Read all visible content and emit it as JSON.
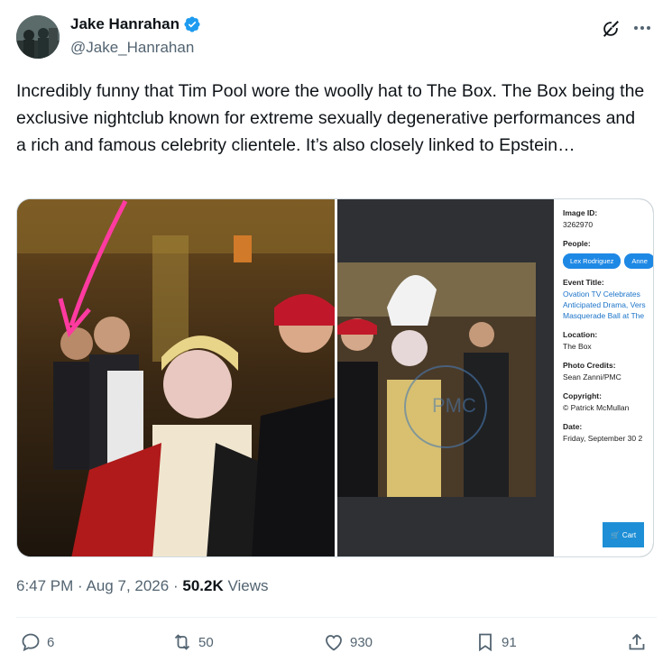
{
  "author": {
    "display_name": "Jake Hanrahan",
    "handle": "@Jake_Hanrahan",
    "avatar_icon": "avatar-photo",
    "verified_color": "#1d9bf0"
  },
  "tweet": {
    "text": "Incredibly funny that Tim Pool wore the woolly hat to The Box. The Box being the exclusive nightclub known for extreme sexually degenerative performances and a rich and famous celebrity clientele. It’s also closely linked to Epstein…"
  },
  "media_panel": {
    "image_id_label": "Image ID:",
    "image_id_value": "3262970",
    "people_label": "People:",
    "people": [
      "Lex Rodriguez",
      "Anne"
    ],
    "event_title_label": "Event Title:",
    "event_title_lines": [
      "Ovation TV Celebrates",
      "Anticipated Drama, Vers",
      "Masquerade Ball at The"
    ],
    "location_label": "Location:",
    "location_value": "The Box",
    "photo_credits_label": "Photo Credits:",
    "photo_credits_value": "Sean Zanni/PMC",
    "copyright_label": "Copyright:",
    "copyright_value": "© Patrick McMullan",
    "date_label": "Date:",
    "date_value": "Friday, September 30 2",
    "cart_label": "Cart",
    "watermark": "PMC"
  },
  "meta": {
    "time": "6:47 PM",
    "sep1": "·",
    "date": "Aug 7, 2026",
    "sep2": "·",
    "views_count": "50.2K",
    "views_label": "Views"
  },
  "actions": {
    "replies": "6",
    "reposts": "50",
    "likes": "930",
    "bookmarks": "91"
  }
}
